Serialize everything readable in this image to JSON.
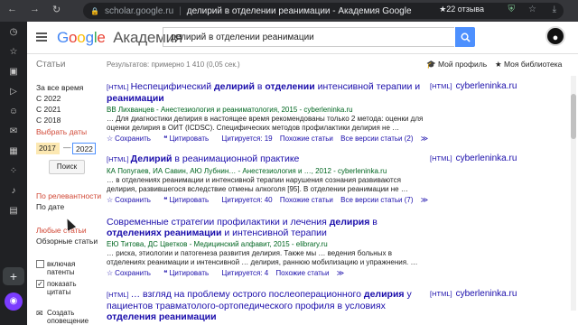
{
  "browser": {
    "url": "scholar.google.ru",
    "page_title": "делирий в отделении реанимации - Академия Google",
    "reviews_badge": "★22 отзыва"
  },
  "header": {
    "logo_google": [
      "G",
      "o",
      "o",
      "g",
      "l",
      "e"
    ],
    "logo_suffix": "Академия",
    "search_value": "делирий в отделении реанимации",
    "avatar_letter": "●"
  },
  "subheader": {
    "section": "Статьи",
    "result_count": "Результатов: примерно 1 410 (0,05 сек.)",
    "my_profile": "Мой профиль",
    "my_library": "Моя библиотека"
  },
  "sidebar": {
    "anytime": "За все время",
    "since_2022": "С 2022",
    "since_2021": "С 2021",
    "since_2018": "С 2018",
    "choose_dates": "Выбрать даты",
    "year_from": "2017",
    "year_to": "2022",
    "search_button": "Поиск",
    "sort_relevance": "По релевантности",
    "sort_date": "По дате",
    "any_type": "Любые статьи",
    "review_articles": "Обзорные статьи",
    "include_patents": "включая патенты",
    "show_citations": "показать цитаты",
    "create_alert": "Создать оповещение"
  },
  "results": [
    {
      "tag": "[HTML]",
      "title_parts": [
        "Неспецифический ",
        "делирий",
        " в ",
        "отделении",
        " интенсивной терапии и ",
        "реанимации"
      ],
      "authors": "ВВ Лихванцев - Анестезиология и реаниматология, 2015 - cyberleninka.ru",
      "snippet": "… Для диагностики делирия в настоящее время рекомендованы только 2 метода: оценки для оценки делирия в ОИТ (ICDSC). Специфических методов профилактики делирия не …",
      "save": "Сохранить",
      "cite": "Цитировать",
      "cited_by": "Цитируется: 19",
      "related": "Похожие статьи",
      "versions": "Все версии статьи (2)",
      "side_tag": "[HTML]",
      "side_source": "cyberleninka.ru"
    },
    {
      "tag": "[HTML]",
      "title_parts": [
        "",
        "Делирий",
        " в реанимационной практике",
        "",
        "",
        ""
      ],
      "authors": "КА Попугаев, ИА Савин, АЮ Лубнин… - Анестезиология и …, 2012 - cyberleninka.ru",
      "snippet": "… в отделениях реанимации и интенсивной терапии нарушения сознания развиваются делирия, развившегося вследствие отмены алкоголя [95]. В отделении реанимации не …",
      "save": "Сохранить",
      "cite": "Цитировать",
      "cited_by": "Цитируется: 40",
      "related": "Похожие статьи",
      "versions": "Все версии статьи (7)",
      "side_tag": "[HTML]",
      "side_source": "cyberleninka.ru"
    },
    {
      "tag": "",
      "title_parts": [
        "Современные стратегии профилактики и лечения ",
        "делирия",
        " в ",
        "отделениях реанимации",
        " и интенсивной терапии",
        ""
      ],
      "authors": "ЕЮ Титова, ДС Цветков - Медицинский алфавит, 2015 - elibrary.ru",
      "snippet": "… риска, этиологии и патогенеза развития делирия. Также мы … ведения больных в отделениях реанимации и интенсивной … делирия, раннюю мобилизацию и упражнения. …",
      "save": "Сохранить",
      "cite": "Цитировать",
      "cited_by": "Цитируется: 4",
      "related": "Похожие статьи",
      "versions": "",
      "side_tag": "",
      "side_source": ""
    },
    {
      "tag": "[HTML]",
      "title_parts": [
        "… взгляд на проблему острого послеоперационного ",
        "делирия",
        " у пациентов травматолого-ортопедического профиля в условиях ",
        "отделения реанимации",
        "",
        ""
      ],
      "authors": "",
      "snippet": "",
      "save": "",
      "cite": "",
      "cited_by": "",
      "related": "",
      "versions": "",
      "side_tag": "[HTML]",
      "side_source": "cyberleninka.ru"
    }
  ]
}
